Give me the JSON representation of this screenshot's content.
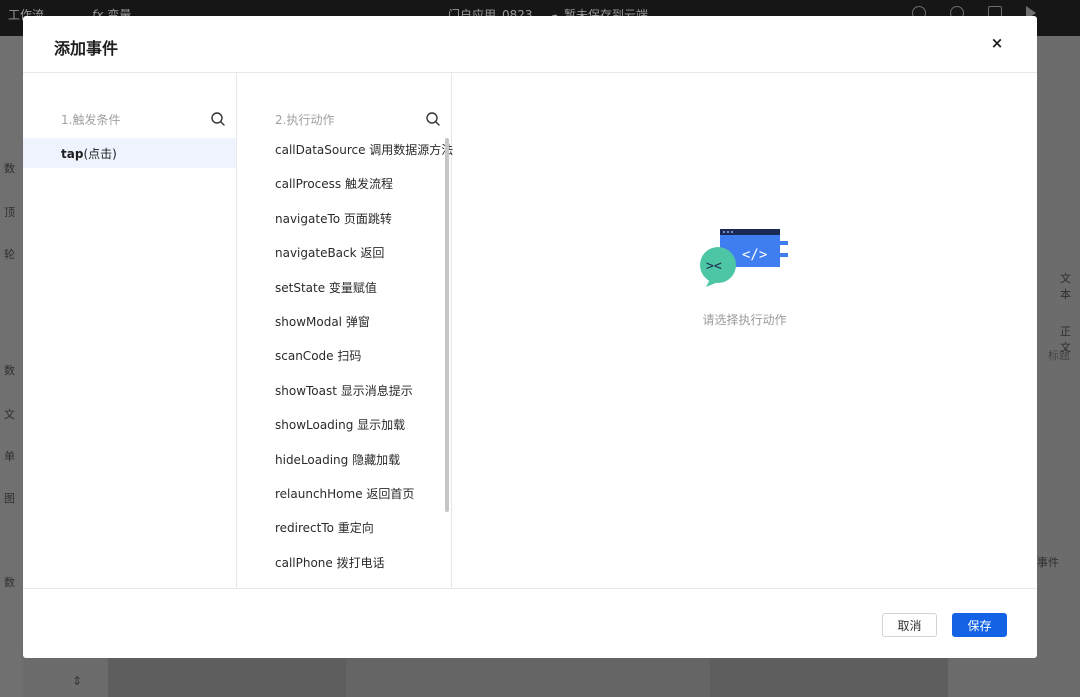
{
  "background": {
    "topbar": {
      "workspace_label": "工作流",
      "variables_label": "变量",
      "app_title": "门户应用_0823",
      "save_status": "暂未保存到云端"
    },
    "left_labels": [
      "数",
      "顶",
      "轮",
      "数",
      "文",
      "单",
      "图",
      "数"
    ],
    "right_labels": [
      "文本",
      "正文",
      "标题",
      "事件"
    ]
  },
  "modal": {
    "title": "添加事件",
    "close_label": "×",
    "trigger": {
      "header": "1.触发条件",
      "selected_main": "tap",
      "selected_sub": "(点击)"
    },
    "action": {
      "header": "2.执行动作",
      "items": [
        "callDataSource 调用数据源方法",
        "callProcess 触发流程",
        "navigateTo 页面跳转",
        "navigateBack 返回",
        "setState 变量赋值",
        "showModal 弹窗",
        "scanCode 扫码",
        "showToast 显示消息提示",
        "showLoading 显示加载",
        "hideLoading 隐藏加载",
        "relaunchHome 返回首页",
        "redirectTo 重定向",
        "callPhone 拨打电话"
      ]
    },
    "detail": {
      "empty_text": "请选择执行动作",
      "illustration_code_text": "</>",
      "illustration_chat_text": "><"
    },
    "footer": {
      "cancel_label": "取消",
      "save_label": "保存"
    }
  },
  "colors": {
    "accent": "#1463e6",
    "selected_bg": "#eef3fd"
  }
}
